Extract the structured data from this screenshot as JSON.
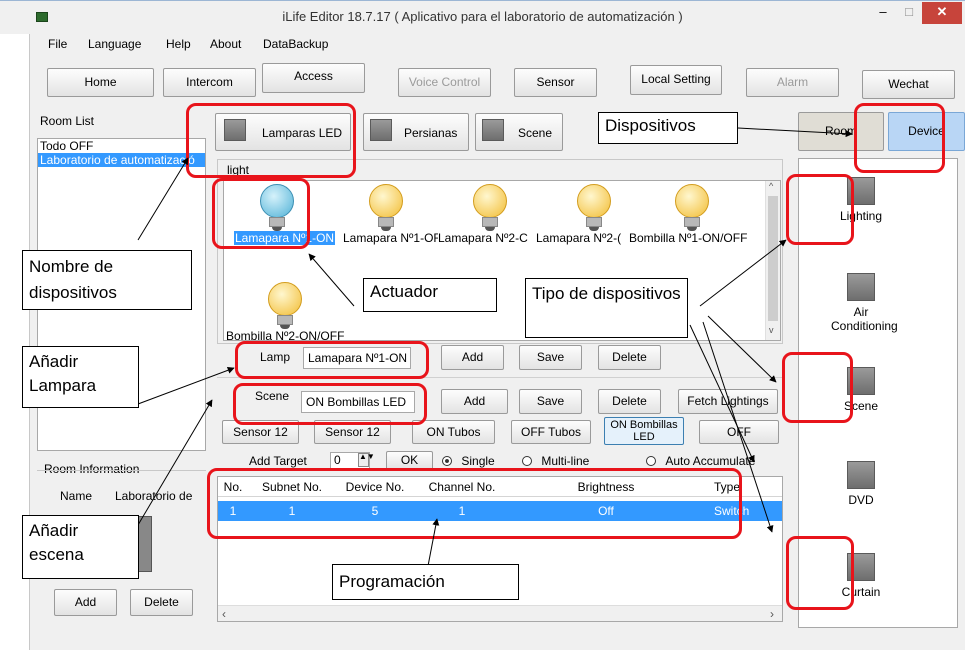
{
  "window": {
    "title": "iLife Editor 18.7.17 ( Aplicativo para el laboratorio de automatización )"
  },
  "menu": [
    "File",
    "Language",
    "Help",
    "About",
    "DataBackup"
  ],
  "toolbar": {
    "home": "Home",
    "intercom": "Intercom",
    "access": "Access",
    "voice": "Voice Control",
    "sensor": "Sensor",
    "local": "Local Setting",
    "alarm": "Alarm",
    "wechat": "Wechat"
  },
  "room_list": {
    "label": "Room List",
    "items": [
      "Todo OFF",
      "Laboratorio de automatizació"
    ]
  },
  "room_info": {
    "label": "Room Information",
    "name_label": "Name",
    "name_value": "Laboratorio de",
    "add": "Add",
    "delete": "Delete"
  },
  "tabs": [
    "Lamparas LED",
    "Persianas",
    "Scene"
  ],
  "group_label": "light",
  "devices": [
    {
      "label": "Lamapara Nº1-ON",
      "state": "selected"
    },
    {
      "label": "Lamapara Nº1-OF",
      "state": "on"
    },
    {
      "label": "Lamapara Nº2-C",
      "state": "on"
    },
    {
      "label": "Lamapara Nº2-(",
      "state": "on"
    },
    {
      "label": "Bombilla Nº1-ON/OFF",
      "state": "on"
    },
    {
      "label": "Bombilla Nº2-ON/OFF",
      "state": "on"
    }
  ],
  "lamp_row": {
    "label": "Lamp",
    "value": "Lamapara Nº1-ON",
    "add": "Add",
    "save": "Save",
    "delete": "Delete"
  },
  "scene_row": {
    "label": "Scene",
    "value": "ON Bombillas LED",
    "add": "Add",
    "save": "Save",
    "delete": "Delete",
    "fetch": "Fetch Lightings"
  },
  "scene_buttons": [
    "Sensor 12",
    "Sensor 12",
    "ON Tubos",
    "OFF Tubos",
    "ON Bombillas LED",
    "OFF"
  ],
  "target": {
    "label": "Add Target",
    "value": "0",
    "ok": "OK",
    "single": "Single",
    "multi": "Multi-line",
    "auto": "Auto Accumulate"
  },
  "table": {
    "headers": [
      "No.",
      "Subnet No.",
      "Device No.",
      "Channel No.",
      "Brightness",
      "Type"
    ],
    "rows": [
      [
        "1",
        "1",
        "5",
        "1",
        "Off",
        "Switch"
      ]
    ]
  },
  "right_panel": {
    "room_btn": "Room",
    "device_btn": "Device",
    "types": [
      "Lighting",
      "Air Conditioning",
      "Scene",
      "DVD",
      "Curtain"
    ]
  },
  "annotations": {
    "dispositivos": "Dispositivos",
    "nombre": "Nombre de dispositivos",
    "actuador": "Actuador",
    "tipo": "Tipo de dispositivos",
    "lampara": "Añadir Lampara",
    "escena": "Añadir escena",
    "programacion": "Programación"
  },
  "colors": {
    "accent": "#3399ff",
    "highlight": "#e8141b",
    "device_btn": "#b9d6f5"
  }
}
